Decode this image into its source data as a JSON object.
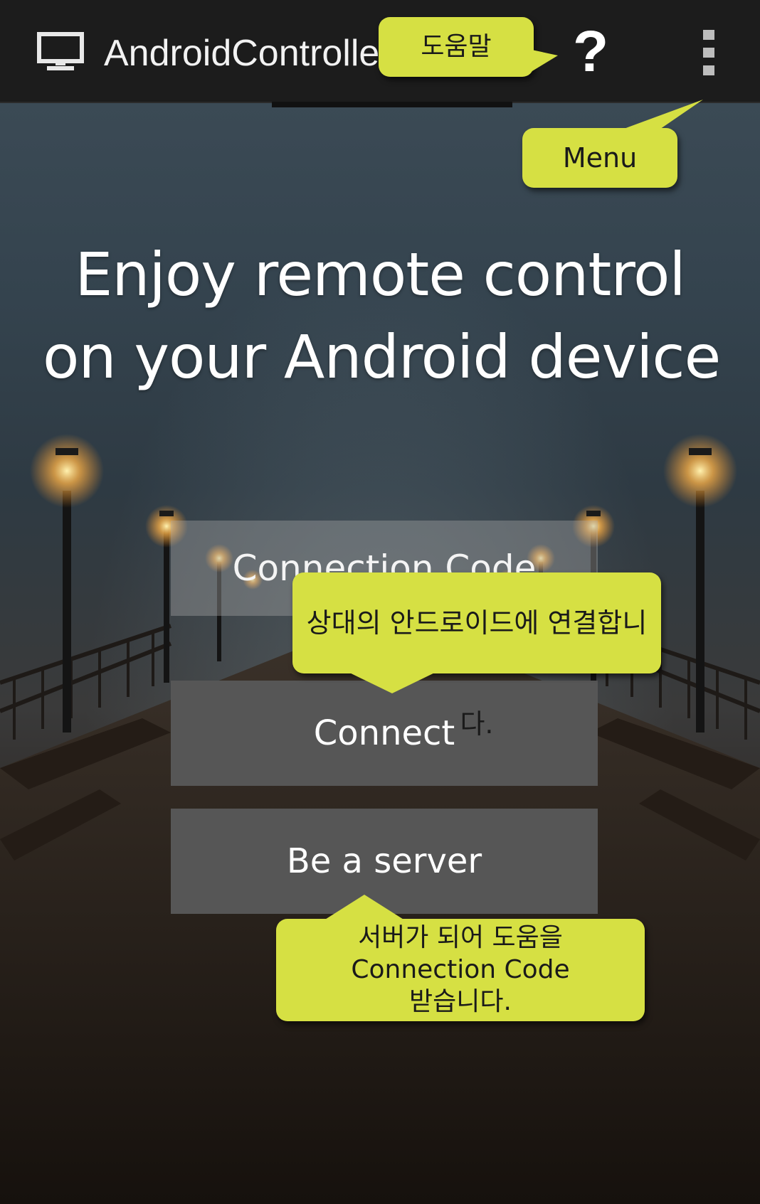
{
  "app_bar": {
    "title": "AndroidControlle",
    "app_icon": "monitor-icon",
    "help_label": "?",
    "help_icon": "question-mark-icon",
    "overflow_icon": "overflow-menu-icon"
  },
  "headline": {
    "line1": "Enjoy remote control",
    "line2": "on your Android device"
  },
  "form": {
    "code_placeholder": "Connection Code",
    "connect_label": "Connect",
    "server_label": "Be a server"
  },
  "callouts": {
    "help": "도움말",
    "menu": "Menu",
    "connect": "상대의 안드로이드에 연결합니다.",
    "server_line1": "서버가 되어 도움을",
    "server_line2": "Connection Code",
    "server_line3": "받습니다."
  },
  "colors": {
    "callout": "#d6e043",
    "app_bar": "#1c1c1c",
    "button": "#565656"
  }
}
